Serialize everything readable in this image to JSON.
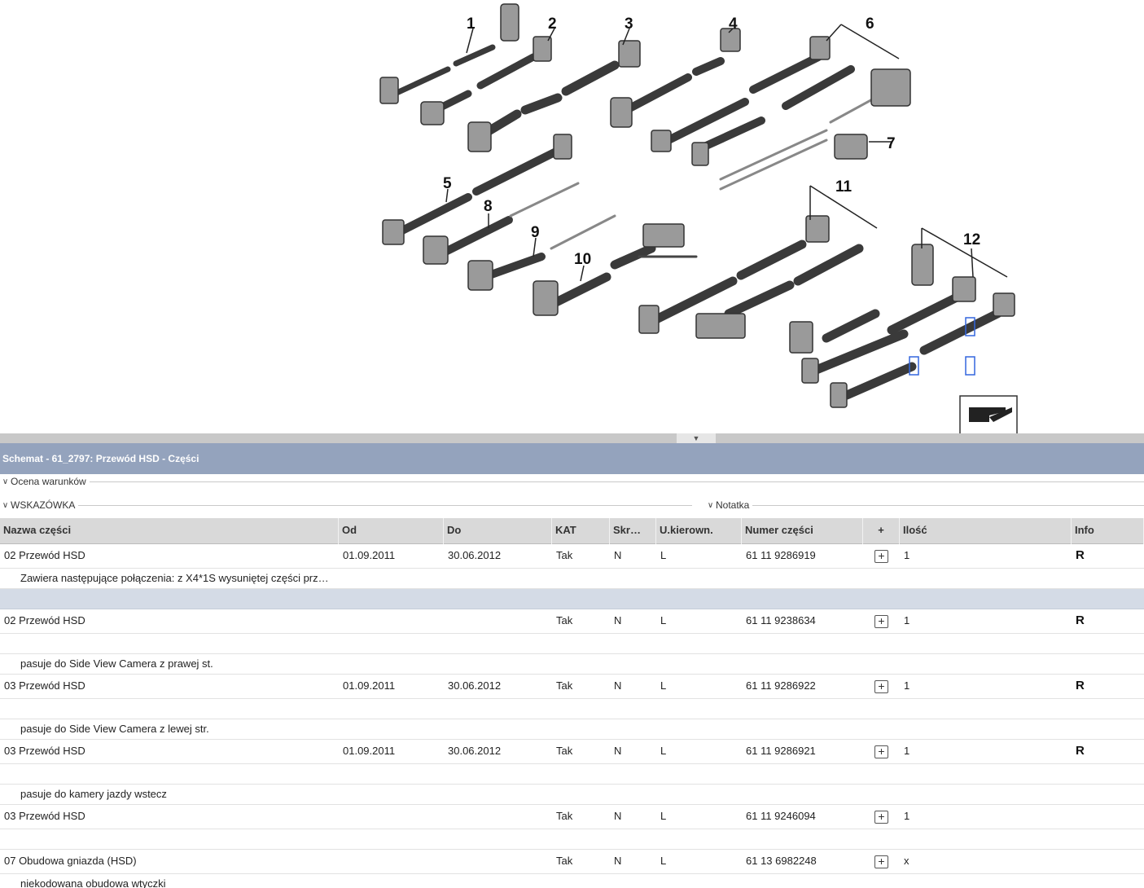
{
  "diagram": {
    "callouts": [
      "1",
      "2",
      "3",
      "4",
      "5",
      "6",
      "7",
      "8",
      "9",
      "10",
      "11",
      "12"
    ]
  },
  "splitter": {
    "handle_icon": "chevron-down-icon"
  },
  "panel": {
    "title": "Schemat - 61_2797: Przewód HSD - Części"
  },
  "sections": {
    "conditions": "Ocena warunków",
    "hint": "WSKAZÓWKA",
    "note": "Notatka"
  },
  "table": {
    "headers": [
      "Nazwa części",
      "Od",
      "Do",
      "KAT",
      "Skr…",
      "U.kierown.",
      "Numer części",
      "+",
      "Ilość",
      "Info"
    ],
    "rows": [
      {
        "name": "02 Przewód HSD",
        "od": "01.09.2011",
        "do": "30.06.2012",
        "kat": "Tak",
        "skr": "N",
        "uk": "L",
        "num": "61 11 9286919",
        "qty": "1",
        "info": "R",
        "note": "Zawiera następujące połączenia: z X4*1S wysuniętej części prz…"
      },
      {
        "name": "02 Przewód HSD",
        "od": "",
        "do": "",
        "kat": "Tak",
        "skr": "N",
        "uk": "L",
        "num": "61 11 9238634",
        "qty": "1",
        "info": "R",
        "note": "pasuje do Side View Camera z prawej st."
      },
      {
        "name": "03 Przewód HSD",
        "od": "01.09.2011",
        "do": "30.06.2012",
        "kat": "Tak",
        "skr": "N",
        "uk": "L",
        "num": "61 11 9286922",
        "qty": "1",
        "info": "R",
        "note": "pasuje do Side View Camera z lewej str."
      },
      {
        "name": "03 Przewód HSD",
        "od": "01.09.2011",
        "do": "30.06.2012",
        "kat": "Tak",
        "skr": "N",
        "uk": "L",
        "num": "61 11 9286921",
        "qty": "1",
        "info": "R",
        "note": "pasuje do kamery jazdy wstecz"
      },
      {
        "name": "03 Przewód HSD",
        "od": "",
        "do": "",
        "kat": "Tak",
        "skr": "N",
        "uk": "L",
        "num": "61 11 9246094",
        "qty": "1",
        "info": "",
        "note": ""
      },
      {
        "name": "07 Obudowa gniazda (HSD)",
        "od": "",
        "do": "",
        "kat": "Tak",
        "skr": "N",
        "uk": "L",
        "num": "61 13 6982248",
        "qty": "x",
        "info": "",
        "note": "niekodowana obudowa wtyczki"
      }
    ]
  }
}
